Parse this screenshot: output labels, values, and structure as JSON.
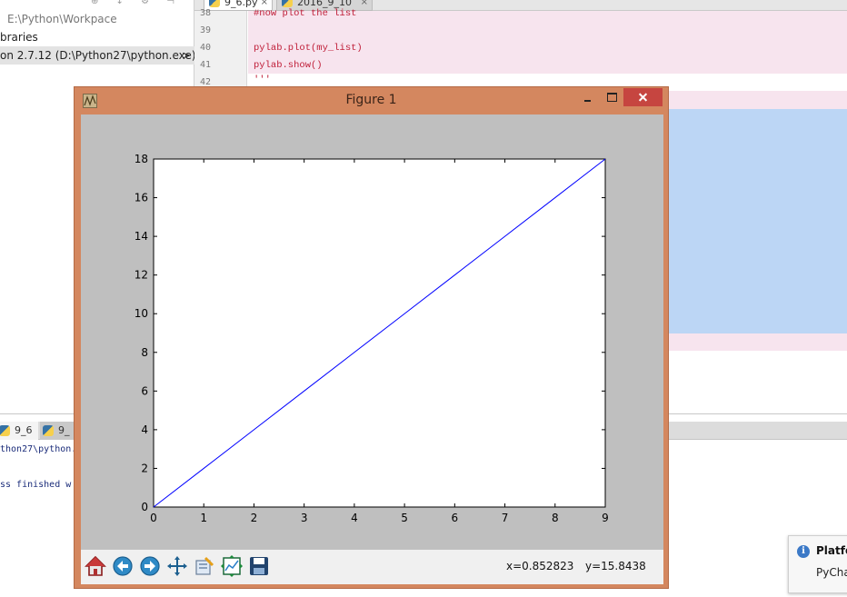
{
  "ide": {
    "project_tree": {
      "path_label": "E:\\Python\\Workpace",
      "libraries_label": "braries",
      "interpreter_label": "on 2.7.12 (D:\\Python27\\python.exe)",
      "interpreter_arrow": ">"
    },
    "editor_tabs": [
      {
        "label": "9_6.py",
        "close": "×",
        "active": true
      },
      {
        "label": "2016_9_10",
        "close": "×",
        "active": false
      }
    ],
    "line_numbers": [
      "38",
      "39",
      "40",
      "41",
      "42"
    ],
    "code_lines": [
      "#now plot the list",
      "",
      "pylab.plot(my_list)",
      "pylab.show()",
      "'''"
    ],
    "run_tabs": [
      {
        "label": "9_6"
      },
      {
        "label": "9_"
      }
    ],
    "console_lines": [
      "thon27\\python.",
      "ss finished w"
    ],
    "notification": {
      "icon": "info-icon",
      "title": "Platfo",
      "body": "PyCha"
    }
  },
  "figure": {
    "window_title": "Figure 1",
    "toolbar": [
      {
        "name": "home-icon",
        "tooltip": "home"
      },
      {
        "name": "back-arrow-icon",
        "tooltip": "back"
      },
      {
        "name": "forward-arrow-icon",
        "tooltip": "forward"
      },
      {
        "name": "pan-icon",
        "tooltip": "pan"
      },
      {
        "name": "zoom-icon",
        "tooltip": "zoom"
      },
      {
        "name": "configure-subplots-icon",
        "tooltip": "subplots"
      },
      {
        "name": "save-icon",
        "tooltip": "save"
      }
    ],
    "cursor_x": "x=0.852823",
    "cursor_y": "y=15.8438"
  },
  "colors": {
    "window_frame": "#d4875f",
    "close_button": "#c64540",
    "figure_bg": "#bfbfbf",
    "line_color": "#0000ff",
    "editor_highlight": "#f7e4ee",
    "editor_selection": "#bcd6f5"
  },
  "chart_data": {
    "type": "line",
    "title": "",
    "xlabel": "",
    "ylabel": "",
    "x": [
      0,
      1,
      2,
      3,
      4,
      5,
      6,
      7,
      8,
      9
    ],
    "series": [
      {
        "values": [
          0,
          2,
          4,
          6,
          8,
          10,
          12,
          14,
          16,
          18
        ],
        "color": "#0000ff"
      }
    ],
    "xlim": [
      0,
      9
    ],
    "ylim": [
      0,
      18
    ],
    "xticks": [
      "0",
      "1",
      "2",
      "3",
      "4",
      "5",
      "6",
      "7",
      "8",
      "9"
    ],
    "yticks": [
      "0",
      "2",
      "4",
      "6",
      "8",
      "10",
      "12",
      "14",
      "16",
      "18"
    ],
    "grid": false
  }
}
